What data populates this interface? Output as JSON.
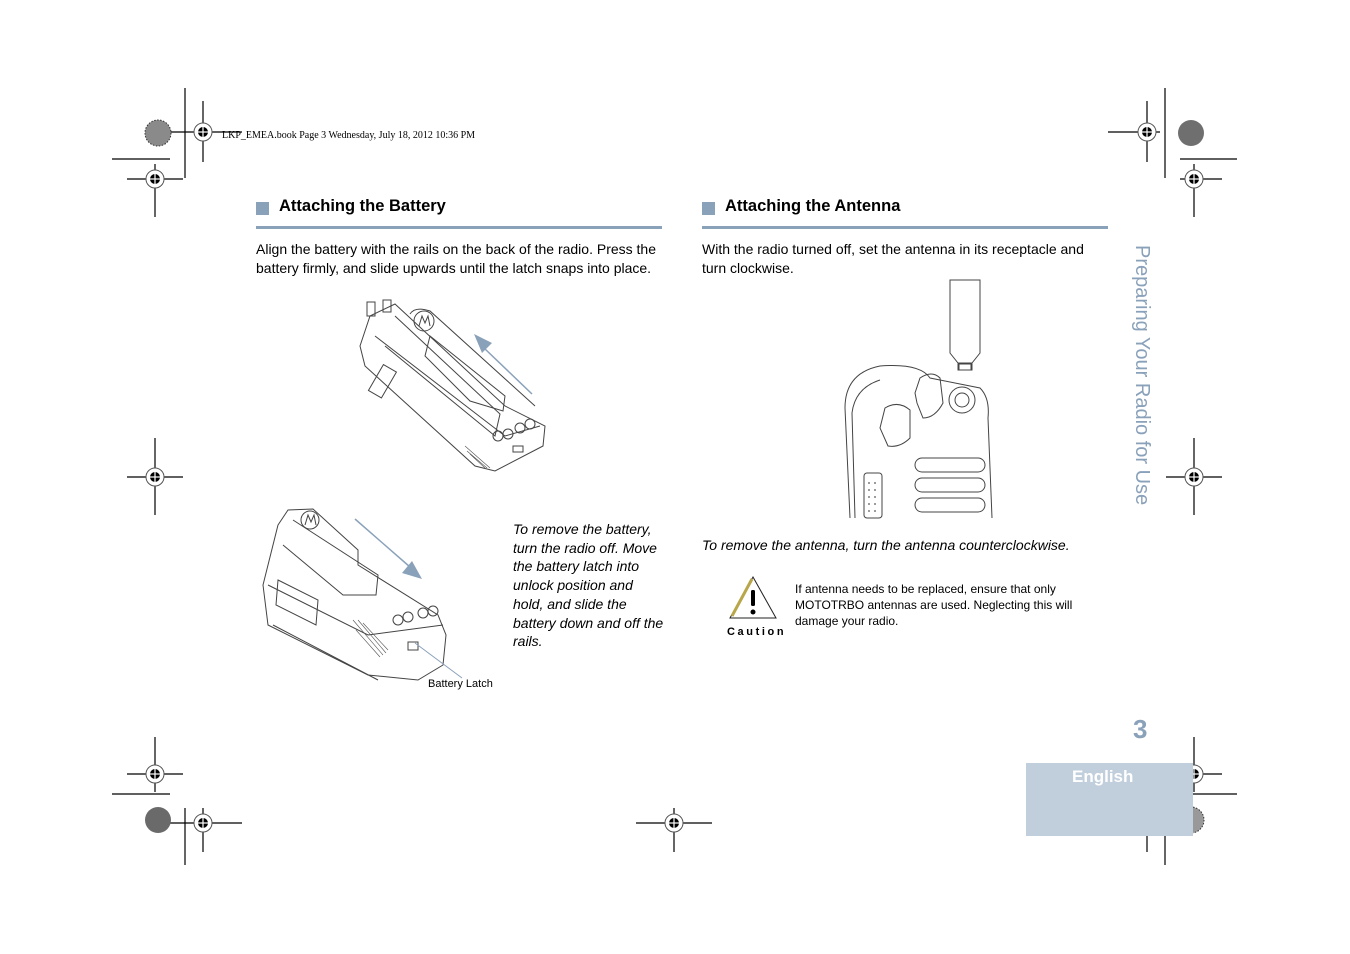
{
  "print_header": "LKP_EMEA.book  Page 3  Wednesday, July 18, 2012  10:36 PM",
  "side_title": "Preparing Your Radio for Use",
  "page_number": "3",
  "language_tab": "English",
  "accent_color": "#8aa1ba",
  "sections": [
    {
      "title": "Attaching the Battery",
      "body": "Align the battery with the rails on the back of the radio. Press the battery firmly, and slide upwards until the latch snaps into place.",
      "removal_note": "To remove the battery, turn the radio off. Move the battery latch into unlock position and hold, and slide the battery down and off the rails.",
      "figure_callout": "Battery Latch"
    },
    {
      "title": "Attaching the Antenna",
      "body": "With the radio turned off, set the antenna in its receptacle and turn clockwise.",
      "removal_note": "To remove the antenna, turn the antenna counterclockwise.",
      "caution": {
        "label": "Caution",
        "text": "If antenna needs to be replaced, ensure that only MOTOTRBO antennas are used. Neglecting this will damage your radio."
      }
    }
  ]
}
